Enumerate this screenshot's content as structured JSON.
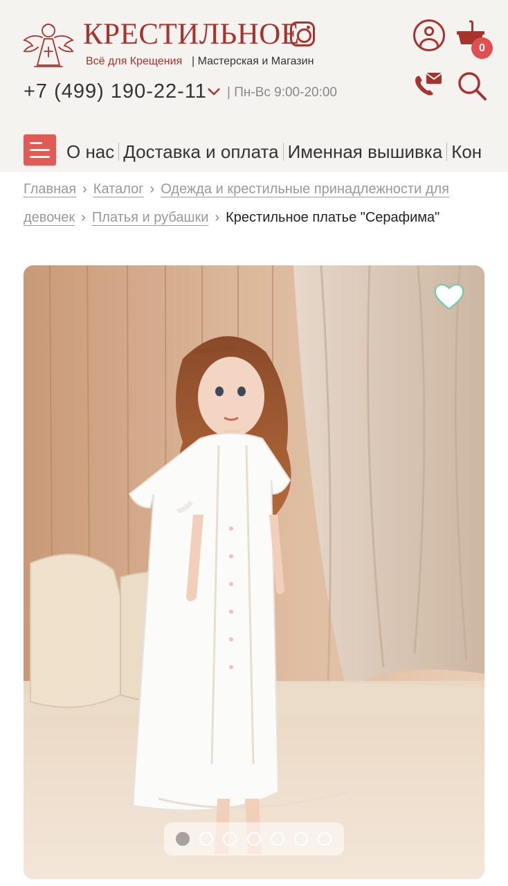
{
  "header": {
    "brand": "КРЕСТИЛЬНОЕ",
    "tagline": "Всё для Крещения",
    "tagline_secondary": "| Мастерская и Магазин",
    "phone": "+7 (499) 190-22-11",
    "hours": "| Пн-Вс 9:00-20:00",
    "cart_count": "0",
    "accent_color": "#a8322c",
    "badge_color": "#e05050"
  },
  "nav": {
    "items": [
      "О нас",
      "Доставка и оплата",
      "Именная вышивка",
      "Кон"
    ]
  },
  "breadcrumb": {
    "items": [
      "Главная",
      "Каталог",
      "Одежда и крестильные принадлежности для девочек",
      "Платья и рубашки"
    ],
    "current": "Крестильное платье \"Серафима\""
  },
  "gallery": {
    "slide_count": 7,
    "active_slide": 1
  },
  "icons": [
    "angel-logo-icon",
    "instagram-icon",
    "user-icon",
    "cart-icon",
    "chevron-down-icon",
    "callback-icon",
    "search-icon",
    "menu-icon",
    "heart-icon",
    "chevron-right-icon"
  ]
}
